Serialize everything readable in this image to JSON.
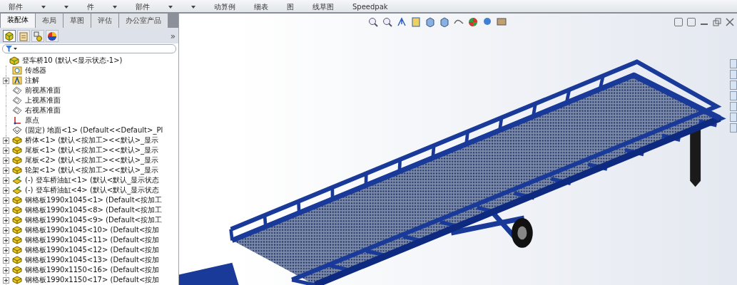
{
  "ribbon": {
    "labels": [
      {
        "text": "部件",
        "caret": false
      },
      {
        "caret": true
      },
      {
        "caret": true
      },
      {
        "text": "件",
        "caret": false
      },
      {
        "caret": true
      },
      {
        "text": "部件",
        "caret": false
      },
      {
        "caret": true
      },
      {
        "caret": true
      },
      {
        "text": "动算例",
        "caret": false
      },
      {
        "text": "细表",
        "caret": false
      },
      {
        "text": "图",
        "caret": false
      },
      {
        "text": "线草图",
        "caret": false
      },
      {
        "text": "Speedpak",
        "caret": false
      }
    ]
  },
  "tabs": [
    {
      "label": "装配体",
      "selected": true
    },
    {
      "label": "布局",
      "selected": false
    },
    {
      "label": "草图",
      "selected": false
    },
    {
      "label": "评估",
      "selected": false
    },
    {
      "label": "办公室产品",
      "selected": false
    }
  ],
  "panel_more": "»",
  "panel_tabs": [
    {
      "kind": "tree",
      "selected": true
    },
    {
      "kind": "properties",
      "selected": false
    },
    {
      "kind": "config",
      "selected": false
    },
    {
      "kind": "appearance",
      "selected": false
    }
  ],
  "tree": {
    "label": "登车桥10 (默认<显示状态-1>)",
    "children": [
      {
        "label": "传感器",
        "kind": "sensor",
        "collapsed": false
      },
      {
        "label": "注解",
        "kind": "annotation",
        "collapsed": true
      },
      {
        "label": "前视基准面",
        "kind": "plane",
        "collapsed": false
      },
      {
        "label": "上视基准面",
        "kind": "plane",
        "collapsed": false
      },
      {
        "label": "右视基准面",
        "kind": "plane",
        "collapsed": false
      },
      {
        "label": "原点",
        "kind": "origin",
        "collapsed": false
      },
      {
        "label": "(固定) 地面<1> (Default<<Default>_Pl",
        "kind": "fixed",
        "collapsed": false
      },
      {
        "label": "桥体<1> (默认<按加工><<默认>_显示",
        "kind": "part",
        "collapsed": true
      },
      {
        "label": "尾板<1> (默认<按加工><<默认>_显示",
        "kind": "part",
        "collapsed": true
      },
      {
        "label": "尾板<2> (默认<按加工><<默认>_显示",
        "kind": "part",
        "collapsed": true
      },
      {
        "label": "轮架<1> (默认<按加工><<默认>_显示",
        "kind": "part",
        "collapsed": true
      },
      {
        "label": "(-) 登车桥油缸<1> (默认<默认_显示状态",
        "kind": "subassembly",
        "collapsed": true
      },
      {
        "label": "(-) 登车桥油缸<4> (默认<默认_显示状态",
        "kind": "subassembly",
        "collapsed": true
      },
      {
        "label": "钢格板1990x1045<1> (Default<按加工",
        "kind": "part",
        "collapsed": true
      },
      {
        "label": "钢格板1990x1045<8> (Default<按加工",
        "kind": "part",
        "collapsed": true
      },
      {
        "label": "钢格板1990x1045<9> (Default<按加工",
        "kind": "part",
        "collapsed": true
      },
      {
        "label": "钢格板1990x1045<10> (Default<按加",
        "kind": "part",
        "collapsed": true
      },
      {
        "label": "钢格板1990x1045<11> (Default<按加",
        "kind": "part",
        "collapsed": true
      },
      {
        "label": "钢格板1990x1045<12> (Default<按加",
        "kind": "part",
        "collapsed": true
      },
      {
        "label": "钢格板1990x1045<13> (Default<按加",
        "kind": "part",
        "collapsed": true
      },
      {
        "label": "钢格板1990x1150<16> (Default<按加",
        "kind": "part",
        "collapsed": true
      },
      {
        "label": "钢格板1990x1150<17> (Default<按加",
        "kind": "part",
        "collapsed": true
      }
    ]
  }
}
